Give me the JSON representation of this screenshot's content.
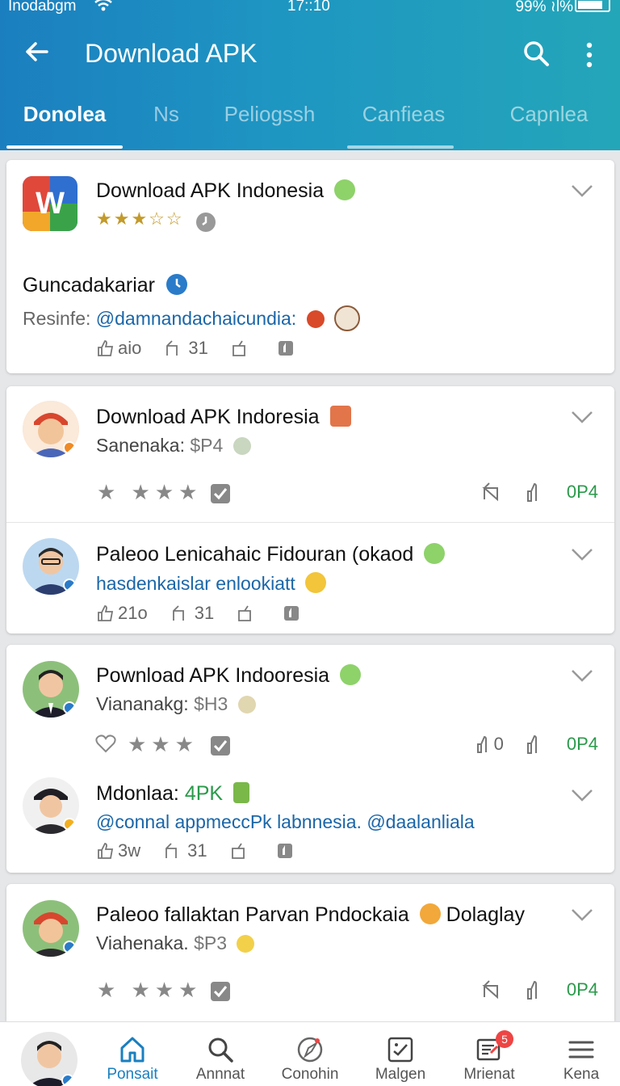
{
  "status": {
    "carrier": "Inodabgm",
    "time": "17::10",
    "battery": "99% ≀l%"
  },
  "appbar": {
    "title": "Download APK"
  },
  "tabs": [
    {
      "label": "Donolea",
      "active": true
    },
    {
      "label": "Ns"
    },
    {
      "label": "Peliogssh"
    },
    {
      "label": "Canfieas"
    },
    {
      "label": "Capnlea"
    }
  ],
  "posts": [
    {
      "title": "Download APK Indonesia",
      "author_name": "Guncadakariar",
      "resinfe_label": "Resinfe:",
      "resinfe_handle": "@damnandachaicundia:",
      "actions": [
        "aio",
        "31"
      ]
    },
    {
      "title": "Download APK Indoresia",
      "sub_label": "Sanenaka:",
      "sub_price": "$P4",
      "right_value": "0P4"
    },
    {
      "title": "Paleoo Lenicahaic Fidouran (okaod",
      "sub": "hasdenkaislar enlookiatt",
      "actions": [
        "21o",
        "31"
      ]
    },
    {
      "title": "Pownload APK Indooresia",
      "sub_label": "Viananakg:",
      "sub_price": "$H3",
      "left_value": "0",
      "right_value": "0P4"
    },
    {
      "title_label": "Mdonlaa:",
      "title_value": "4PK",
      "sub": "@connal appmeccPk labnnesia. @daalanliala",
      "actions": [
        "3w",
        "31"
      ]
    },
    {
      "title": "Paleoo fallaktan Parvan Pndockaia",
      "title_suffix": "Dolaglay",
      "sub_label": "Viahenaka.",
      "sub_price": "$P3",
      "right_value": "0P4"
    }
  ],
  "bottomnav": [
    {
      "label": "",
      "icon": "avatar"
    },
    {
      "label": "Ponsait",
      "icon": "home-icon",
      "active": true
    },
    {
      "label": "Annnat",
      "icon": "search-icon"
    },
    {
      "label": "Conohin",
      "icon": "compass-icon"
    },
    {
      "label": "Malgen",
      "icon": "gallery-icon"
    },
    {
      "label": "Mrienat",
      "icon": "news-icon",
      "badge": "5"
    },
    {
      "label": "Kena",
      "icon": "menu-icon"
    }
  ],
  "colors": {
    "accent": "#1a7fc0",
    "green": "#2a9a4a",
    "link": "#1a66a8"
  }
}
